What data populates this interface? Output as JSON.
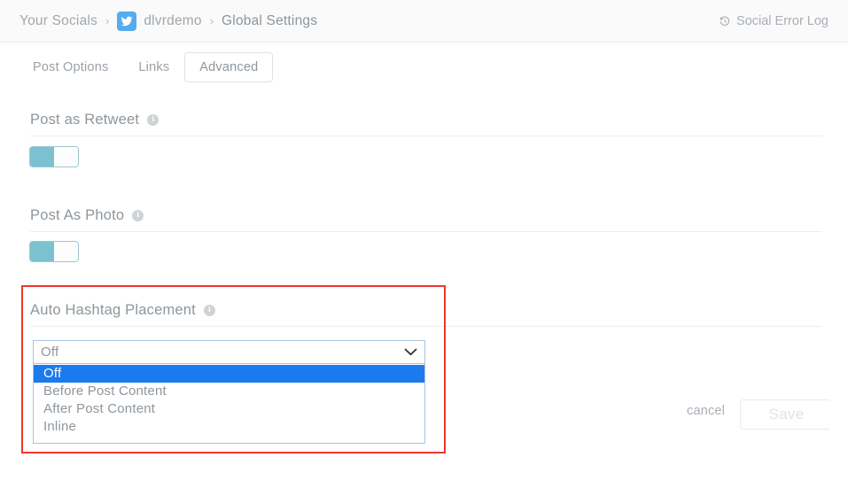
{
  "header": {
    "breadcrumb": [
      {
        "label": "Your Socials",
        "icon": ""
      },
      {
        "label": "dlvrdemo",
        "icon": "twitter-icon"
      },
      {
        "label": "Global Settings",
        "icon": ""
      }
    ],
    "separator": "›",
    "error_log_label": "Social Error Log",
    "error_log_icon": "history-icon"
  },
  "tabs": [
    {
      "label": "Post Options",
      "selected": false
    },
    {
      "label": "Links",
      "selected": false
    },
    {
      "label": "Advanced",
      "selected": true
    }
  ],
  "sections": {
    "retweet": {
      "label": "Post as Retweet",
      "info_icon": "info-icon",
      "info_glyph": "i",
      "toggle_state": "on"
    },
    "photo": {
      "label": "Post As Photo",
      "info_icon": "info-icon",
      "info_glyph": "i",
      "toggle_state": "on"
    },
    "hashtag": {
      "label": "Auto Hashtag Placement",
      "info_icon": "info-icon",
      "info_glyph": "i",
      "select_value": "Off",
      "select_open": true,
      "options": [
        {
          "label": "Off",
          "selected": true
        },
        {
          "label": "Before Post Content",
          "selected": false
        },
        {
          "label": "After Post Content",
          "selected": false
        },
        {
          "label": "Inline",
          "selected": false
        }
      ]
    }
  },
  "footer": {
    "cancel_label": "cancel",
    "save_label": "Save",
    "save_disabled": true
  },
  "colors": {
    "accent_blue": "#55acee",
    "select_highlight": "#1a7aee",
    "toggle_on": "#7cc1cf",
    "highlight_outline": "#f0372e",
    "text_muted": "#9aa1a8",
    "topbar_bg": "#fafafa"
  }
}
